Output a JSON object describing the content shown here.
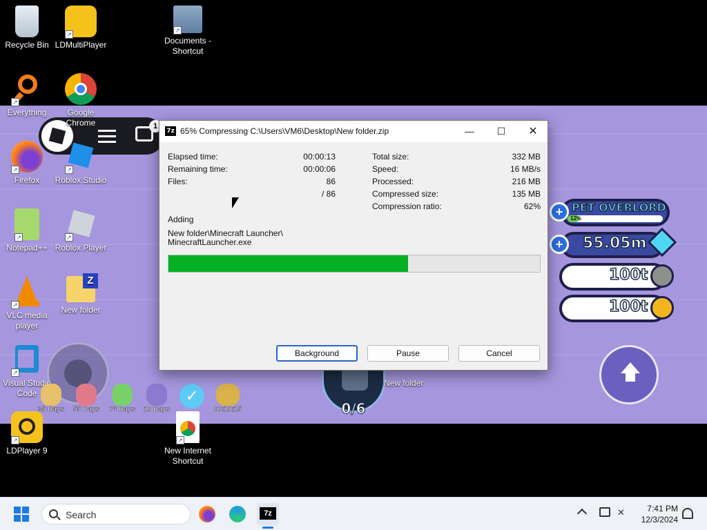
{
  "desktop": {
    "icons": [
      {
        "label": "Recycle Bin"
      },
      {
        "label": "LDMultiPlayer"
      },
      {
        "label": "Documents - Shortcut"
      },
      {
        "label": "Everything"
      },
      {
        "label": "Google Chrome"
      },
      {
        "label": "Firefox"
      },
      {
        "label": "Roblox Studio"
      },
      {
        "label": "Notepad++"
      },
      {
        "label": "Roblox Player"
      },
      {
        "label": "VLC media player"
      },
      {
        "label": "New folder"
      },
      {
        "label": "Visual Studio Code"
      },
      {
        "label": "LDPlayer 9"
      },
      {
        "label": "New Internet Shortcut"
      },
      {
        "label": "New folder"
      }
    ]
  },
  "game": {
    "notification_count": "1",
    "pet_overlord": {
      "label": "PET OVERLORD",
      "progress_text": "12%",
      "progress": 0.12
    },
    "gems": "55.05m",
    "coins1": "100t",
    "coins2": "100t",
    "boosts": [
      "35 Days",
      "55 Days",
      "76 Days",
      "10 Days",
      "00:10:15"
    ],
    "counter": "0/6"
  },
  "dialog": {
    "title": "65% Compressing C:\\Users\\VM6\\Desktop\\New folder.zip",
    "stats_left": [
      {
        "label": "Elapsed time:",
        "value": "00:00:13"
      },
      {
        "label": "Remaining time:",
        "value": "00:00:06"
      },
      {
        "label": "Files:",
        "value": "86"
      },
      {
        "label": "",
        "value": "/ 86"
      }
    ],
    "stats_right": [
      {
        "label": "Total size:",
        "value": "332 MB"
      },
      {
        "label": "Speed:",
        "value": "16 MB/s"
      },
      {
        "label": "Processed:",
        "value": "216 MB"
      },
      {
        "label": "Compressed size:",
        "value": "135 MB"
      },
      {
        "label": "Compression ratio:",
        "value": "62%"
      }
    ],
    "action": "Adding",
    "file_line1": "New folder\\Minecraft Launcher\\",
    "file_line2": "MinecraftLauncher.exe",
    "progress": 0.645,
    "buttons": {
      "background": "Background",
      "pause": "Pause",
      "cancel": "Cancel"
    }
  },
  "taskbar": {
    "search_placeholder": "Search",
    "time": "7:41 PM",
    "date": "12/3/2024"
  },
  "colors": {
    "game_bg": "#a596de",
    "progress_green": "#06b025",
    "accent_blue": "#2a63c9"
  }
}
